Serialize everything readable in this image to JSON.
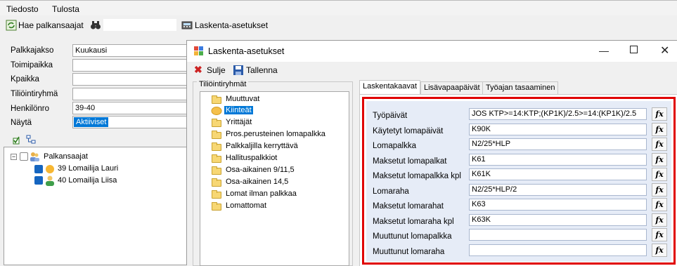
{
  "menubar": {
    "items": [
      "Tiedosto",
      "Tulosta"
    ]
  },
  "toolbar": {
    "search_label": "Hae palkansaajat",
    "settings_label": "Laskenta-asetukset"
  },
  "filters": [
    {
      "label": "Palkkajakso",
      "value": "Kuukausi"
    },
    {
      "label": "Toimipaikka",
      "value": ""
    },
    {
      "label": "Kpaikka",
      "value": ""
    },
    {
      "label": "Tiliöintiryhmä",
      "value": ""
    },
    {
      "label": "Henkilönro",
      "value": "39-40"
    },
    {
      "label": "Näytä",
      "value": "Aktiiviset"
    }
  ],
  "tree": {
    "root": "Palkansaajat",
    "items": [
      "39 Lomailija Lauri",
      "40 Lomailija Liisa"
    ]
  },
  "dialog": {
    "title": "Laskenta-asetukset",
    "close_label": "Sulje",
    "save_label": "Tallenna",
    "groups_label": "Tiliöintiryhmät",
    "groups": [
      "Muuttuvat",
      "Kiinteät",
      "Yrittäjät",
      "Pros.perusteinen lomapalkka",
      "Palkkaljilla kerryttävä",
      "Hallituspalkkiot",
      "Osa-aikainen 9/11,5",
      "Osa-aikainen 14,5",
      "Lomat ilman palkkaa",
      "Lomattomat"
    ],
    "selected_group": "Kiinteät",
    "tabs": [
      "Laskentakaavat",
      "Lisävapaapäivät",
      "Työajan tasaaminen"
    ],
    "fx_label": "fx",
    "formulas": [
      {
        "label": "Työpäivät",
        "value": "JOS KTP>=14:KTP;(KP1K)/2.5>=14:(KP1K)/2.5"
      },
      {
        "label": "Käytetyt lomapäivät",
        "value": "K90K"
      },
      {
        "label": "Lomapalkka",
        "value": "N2/25*HLP"
      },
      {
        "label": "Maksetut lomapalkat",
        "value": "K61"
      },
      {
        "label": "Maksetut lomapalkka kpl",
        "value": "K61K"
      },
      {
        "label": "Lomaraha",
        "value": "N2/25*HLP/2"
      },
      {
        "label": "Maksetut lomarahat",
        "value": "K63"
      },
      {
        "label": "Maksetut lomaraha kpl",
        "value": "K63K"
      },
      {
        "label": "Muuttunut lomapalkka",
        "value": ""
      },
      {
        "label": "Muuttunut lomaraha",
        "value": ""
      }
    ]
  },
  "colors": {
    "highlight_border": "#e00000",
    "selection": "#0078d7",
    "form_panel": "#e6ecf7"
  }
}
